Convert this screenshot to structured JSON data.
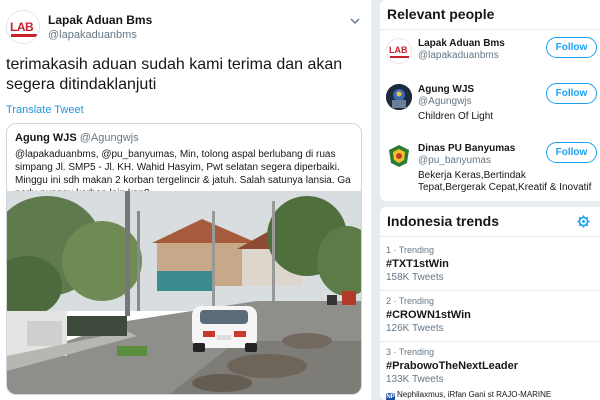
{
  "tweet": {
    "author_name": "Lapak Aduan Bms",
    "author_handle": "@lapakaduanbms",
    "avatar_text": "LAB",
    "text": "terimakasih aduan sudah kami terima dan akan segera ditindaklanjuti",
    "translate_label": "Translate Tweet",
    "quote": {
      "name": "Agung WJS",
      "handle": "@Agungwjs",
      "text": "@lapakaduanbms, @pu_banyumas, Min, tolong aspal berlubang di ruas simpang Jl. SMP5 - Jl. KH. Wahid Hasyim, Pwt selatan segera diperbaiki. Minggu ini sdh makan 2 korban tergelincir & jatuh. Salah satunya lansia. Ga perlu nunggu korban lain kan?..."
    }
  },
  "relevant_people": {
    "title": "Relevant people",
    "people": [
      {
        "name": "Lapak Aduan Bms",
        "handle": "@lapakaduanbms",
        "bio": "",
        "follow_label": "Follow",
        "avatar": "lab-logo"
      },
      {
        "name": "Agung WJS",
        "handle": "@Agungwjs",
        "bio": "Children Of Light",
        "follow_label": "Follow",
        "avatar": "profile-photo"
      },
      {
        "name": "Dinas PU Banyumas",
        "handle": "@pu_banyumas",
        "bio": "Bekerja Keras,Bertindak Tepat,Bergerak Cepat,Kreatif & Inovatif",
        "follow_label": "Follow",
        "avatar": "pu-emblem"
      }
    ]
  },
  "trends": {
    "title": "Indonesia trends",
    "items": [
      {
        "meta": "1 · Trending",
        "tag": "#TXT1stWin",
        "count": "158K Tweets"
      },
      {
        "meta": "2 · Trending",
        "tag": "#CROWN1stWin",
        "count": "126K Tweets"
      },
      {
        "meta": "3 · Trending",
        "tag": "#PrabowoTheNextLeader",
        "count": "133K Tweets"
      }
    ],
    "footer_text": "Nephilaxmus, iRfan Gani st RAJO-MARINE",
    "footer_badge": "NP"
  },
  "colors": {
    "accent": "#1da1f2",
    "link": "#1b95e0",
    "secondary_text": "#657786",
    "lab_red": "#c8202f"
  }
}
